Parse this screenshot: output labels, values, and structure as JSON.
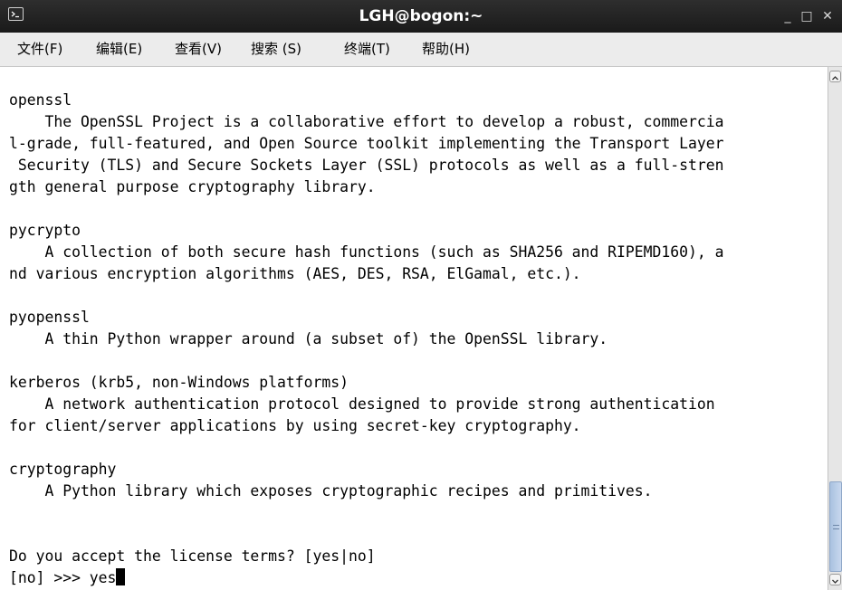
{
  "window": {
    "title": "LGH@bogon:~",
    "icons": [
      "terminal-icon",
      "minimize-icon",
      "maximize-icon",
      "close-icon"
    ],
    "controls": {
      "minimize": "_",
      "maximize": "□",
      "close": "✕"
    }
  },
  "menu": {
    "items": [
      "文件(F)",
      "编辑(E)",
      "查看(V)",
      "搜索 (S)",
      "终端(T)",
      "帮助(H)"
    ]
  },
  "terminal": {
    "lines": [
      "openssl",
      "    The OpenSSL Project is a collaborative effort to develop a robust, commercia",
      "l-grade, full-featured, and Open Source toolkit implementing the Transport Layer",
      " Security (TLS) and Secure Sockets Layer (SSL) protocols as well as a full-stren",
      "gth general purpose cryptography library.",
      "",
      "pycrypto",
      "    A collection of both secure hash functions (such as SHA256 and RIPEMD160), a",
      "nd various encryption algorithms (AES, DES, RSA, ElGamal, etc.).",
      "",
      "pyopenssl",
      "    A thin Python wrapper around (a subset of) the OpenSSL library.",
      "",
      "kerberos (krb5, non-Windows platforms)",
      "    A network authentication protocol designed to provide strong authentication",
      "for client/server applications by using secret-key cryptography.",
      "",
      "cryptography",
      "    A Python library which exposes cryptographic recipes and primitives.",
      "",
      "",
      "Do you accept the license terms? [yes|no]",
      "[no] >>> yes"
    ]
  },
  "colors": {
    "titlebar": "#1f1f1f",
    "menubar": "#ececec",
    "terminal_bg": "#ffffff",
    "terminal_fg": "#000000",
    "scroll_thumb": "#b8cde8"
  }
}
